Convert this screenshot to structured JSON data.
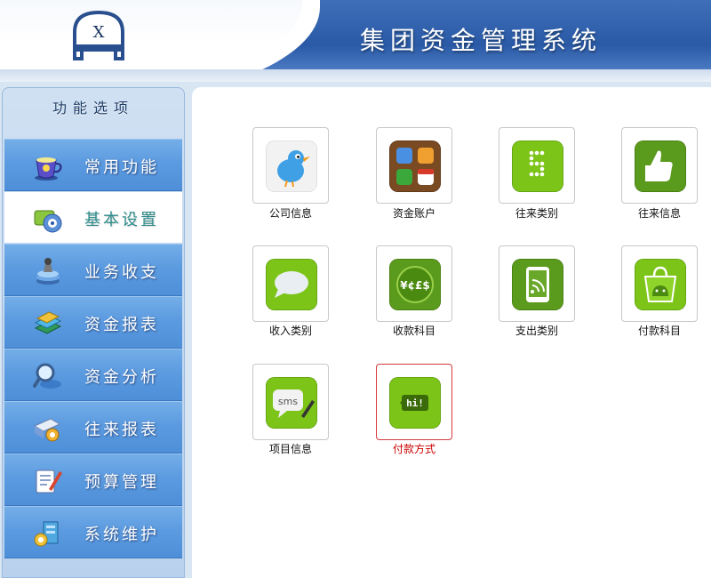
{
  "header": {
    "logo_text": "X",
    "title": "集团资金管理系统"
  },
  "sidebar": {
    "title": "功能选项",
    "active_index": 1,
    "items": [
      {
        "label": "常用功能",
        "icon": "coffee-cup-icon"
      },
      {
        "label": "基本设置",
        "icon": "settings-disc-icon"
      },
      {
        "label": "业务收支",
        "icon": "coin-stack-icon"
      },
      {
        "label": "资金报表",
        "icon": "books-icon"
      },
      {
        "label": "资金分析",
        "icon": "magnifier-icon"
      },
      {
        "label": "往来报表",
        "icon": "document-gear-icon"
      },
      {
        "label": "预算管理",
        "icon": "edit-document-icon"
      },
      {
        "label": "系统维护",
        "icon": "maintenance-icon"
      }
    ]
  },
  "main": {
    "selected_tile": "付款方式",
    "tiles": [
      {
        "label": "公司信息",
        "icon": "bird-icon"
      },
      {
        "label": "资金账户",
        "icon": "apps-grid-icon"
      },
      {
        "label": "往来类别",
        "icon": "dots-s-icon"
      },
      {
        "label": "往来信息",
        "icon": "thumbs-up-icon"
      },
      {
        "label": "收入类别",
        "icon": "speech-bubble-icon"
      },
      {
        "label": "收款科目",
        "icon": "currency-icon",
        "icon_text": "¥¢£$"
      },
      {
        "label": "支出类别",
        "icon": "tablet-rss-icon"
      },
      {
        "label": "付款科目",
        "icon": "android-bag-icon"
      },
      {
        "label": "项目信息",
        "icon": "sms-icon",
        "icon_text": "sms"
      },
      {
        "label": "付款方式",
        "icon": "hi-bubble-icon",
        "icon_text": "hi!"
      }
    ]
  },
  "colors": {
    "header_blue": "#2a5aa6",
    "menu_blue": "#5c9be0",
    "active_label": "#2e8c8c",
    "selected_border": "#d43a3a",
    "selected_label": "#cc0000",
    "tile_green": "#7cc418"
  }
}
